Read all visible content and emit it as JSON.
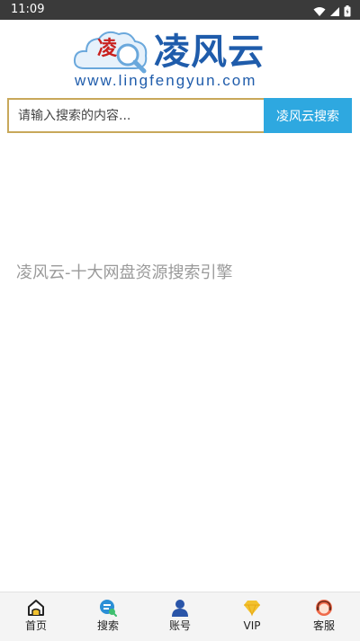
{
  "status_bar": {
    "time": "11:09"
  },
  "logo": {
    "badge_char": "凌",
    "title": "凌风云",
    "url": "www.lingfengyun.com"
  },
  "search": {
    "placeholder": "请输入搜索的内容...",
    "button_label": "凌风云搜索"
  },
  "tagline": "凌风云-十大网盘资源搜索引擎",
  "bottom_nav": {
    "items": [
      {
        "label": "首页",
        "icon": "home-icon"
      },
      {
        "label": "搜索",
        "icon": "search-icon"
      },
      {
        "label": "账号",
        "icon": "user-icon"
      },
      {
        "label": "VIP",
        "icon": "diamond-icon"
      },
      {
        "label": "客服",
        "icon": "support-icon"
      }
    ]
  },
  "colors": {
    "brand_blue": "#1f5cab",
    "button_blue": "#2ea8e0",
    "input_border": "#c8a85a",
    "badge_red": "#c9201e",
    "vip_gold": "#f2c230"
  }
}
